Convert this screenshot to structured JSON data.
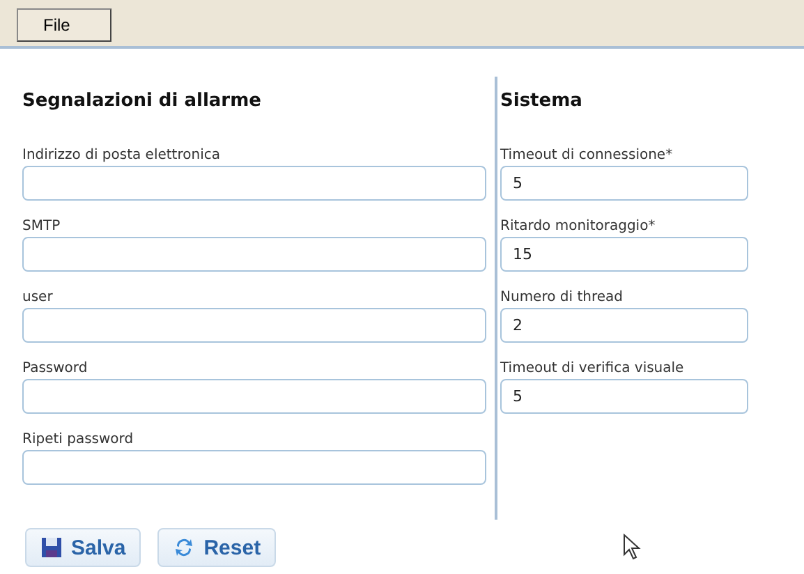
{
  "menu": [
    "File"
  ],
  "columns": [
    {
      "title": "Segnalazioni di allarme",
      "fields": [
        {
          "label": "Indirizzo di posta elettronica"
        },
        {
          "label": "SMTP"
        },
        {
          "label": "user"
        },
        {
          "label": "Password"
        },
        {
          "label": "Ripeti password"
        }
      ]
    },
    {
      "title": "Sistema",
      "fields": [
        {
          "label": "Timeout di connessione*",
          "value": "5"
        },
        {
          "label": "Ritardo monitoraggio*",
          "value": "15"
        },
        {
          "label": "Numero di thread",
          "value": "2"
        },
        {
          "label": "Timeout di verifica visuale",
          "value": "5"
        }
      ]
    }
  ],
  "buttons": [
    {
      "label": "Salva",
      "kind": "save"
    },
    {
      "label": "Reset",
      "kind": "reset"
    }
  ]
}
